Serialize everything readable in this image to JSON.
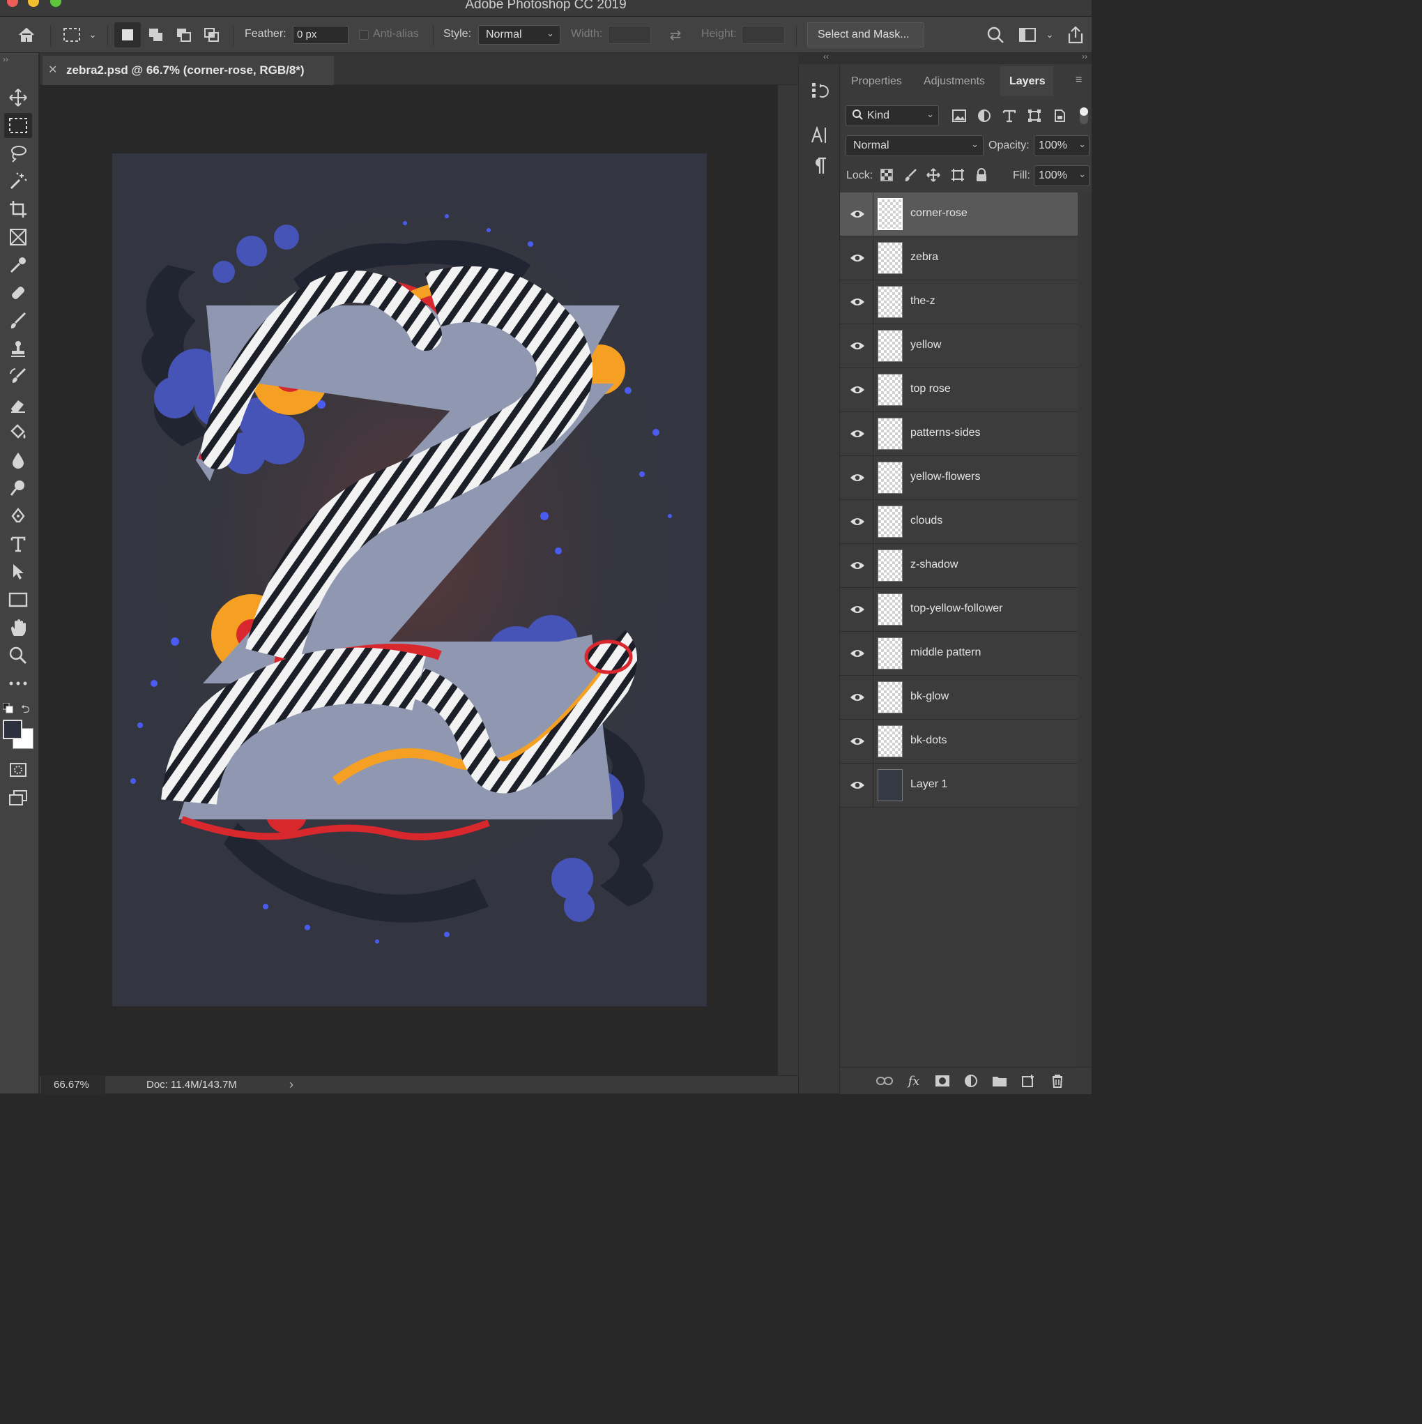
{
  "window": {
    "title": "Adobe Photoshop CC 2019"
  },
  "options_bar": {
    "feather_label": "Feather:",
    "feather_value": "0 px",
    "antialias_label": "Anti-alias",
    "style_label": "Style:",
    "style_value": "Normal",
    "width_label": "Width:",
    "height_label": "Height:",
    "select_mask_label": "Select and Mask..."
  },
  "document": {
    "tab_title": "zebra2.psd @ 66.7% (corner-rose, RGB/8*)",
    "artwork_description_icon": "zebra-z-illustration"
  },
  "status_bar": {
    "zoom": "66.67%",
    "doc_size": "Doc: 11.4M/143.7M"
  },
  "panel": {
    "tabs": [
      {
        "label": "Properties"
      },
      {
        "label": "Adjustments"
      },
      {
        "label": "Layers"
      }
    ],
    "filter_kind": "Kind",
    "blend_mode": "Normal",
    "opacity_label": "Opacity:",
    "opacity_value": "100%",
    "lock_label": "Lock:",
    "fill_label": "Fill:",
    "fill_value": "100%"
  },
  "layers": [
    {
      "name": "corner-rose"
    },
    {
      "name": "zebra"
    },
    {
      "name": "the-z"
    },
    {
      "name": "yellow"
    },
    {
      "name": "top rose"
    },
    {
      "name": "patterns-sides"
    },
    {
      "name": "yellow-flowers"
    },
    {
      "name": "clouds"
    },
    {
      "name": "z-shadow"
    },
    {
      "name": "top-yellow-follower"
    },
    {
      "name": "middle pattern"
    },
    {
      "name": "bk-glow"
    },
    {
      "name": "bk-dots"
    },
    {
      "name": "Layer 1"
    }
  ],
  "colors": {
    "accent_red": "#d9272e",
    "accent_orange": "#f5a023",
    "z_gray": "#8f98b0",
    "cloud_blue": "#4654b8",
    "artboard_bg": "#333640"
  }
}
